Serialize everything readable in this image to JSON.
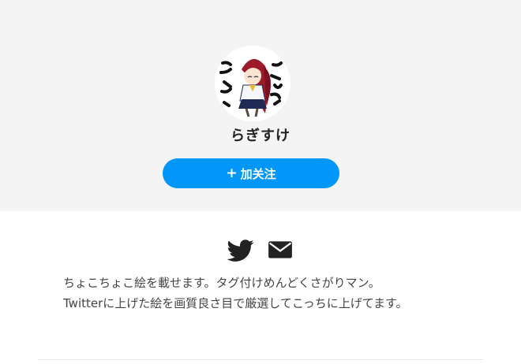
{
  "profile": {
    "name": "らぎすけ",
    "avatar_icon": "anime-girl-avatar-icon"
  },
  "actions": {
    "follow_plus": "+",
    "follow_label": "加关注",
    "follow_color": "#0096fa"
  },
  "social": {
    "links": [
      "twitter-icon",
      "mail-icon"
    ]
  },
  "bio": {
    "line1": "ちょこちょこ絵を載せます。タグ付けめんどくさがりマン。",
    "line2": "Twitterに上げた絵を画質良さ目で厳選してこっちに上げてます。"
  }
}
